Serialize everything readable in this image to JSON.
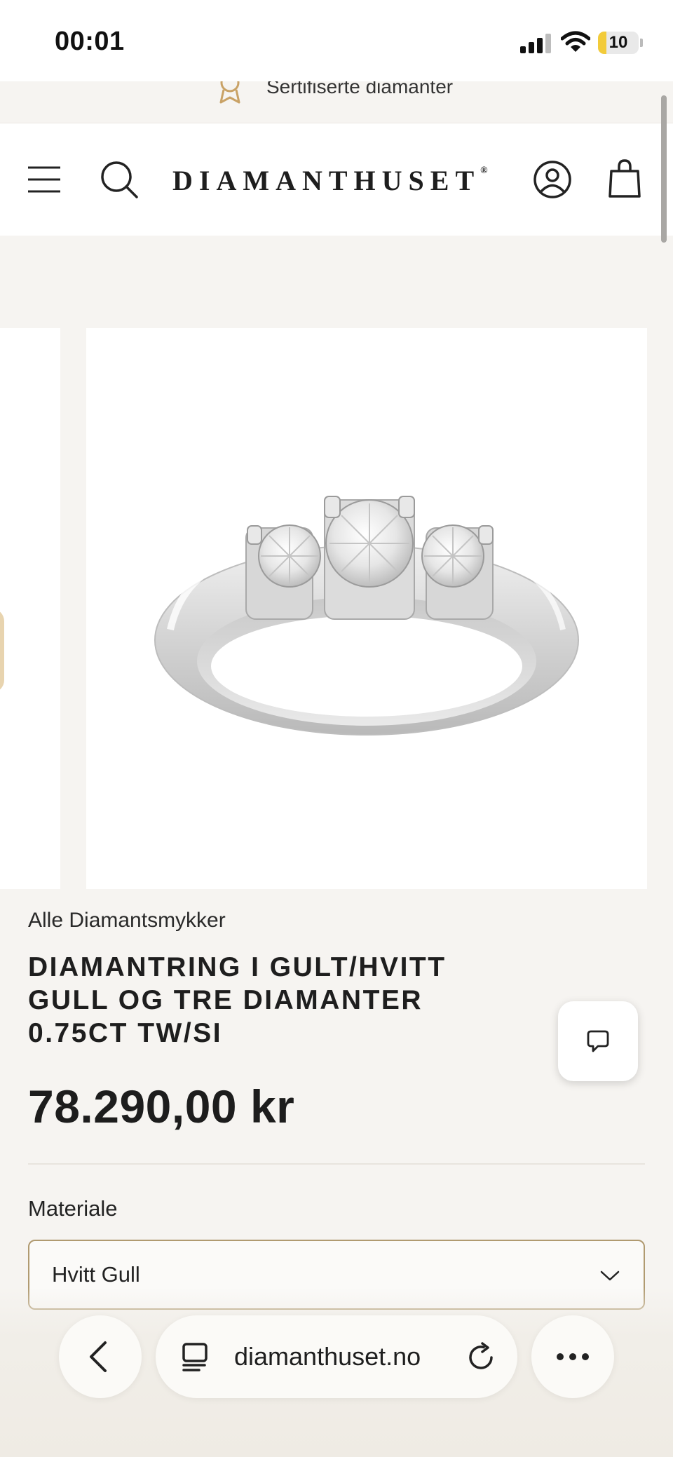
{
  "status_bar": {
    "time": "00:01",
    "battery_label": "10",
    "signal_icon": "cellular-signal-icon",
    "wifi_icon": "wifi-icon",
    "battery_icon": "battery-icon"
  },
  "announcement": {
    "icon": "award-ribbon-icon",
    "text": "Sertifiserte diamanter"
  },
  "header": {
    "logo": "DIAMANTHUSET",
    "logo_mark": "®",
    "icons": [
      "menu-icon",
      "search-icon",
      "account-icon",
      "shopping-bag-icon"
    ]
  },
  "gallery": {
    "main_image": "diamond-ring-image",
    "description_icon": "three-stone-ring"
  },
  "product": {
    "breadcrumb": "Alle Diamantsmykker",
    "title": "DIAMANTRING I GULT/HVITT GULL OG TRE DIAMANTER 0.75CT TW/SI",
    "price": "78.290,00 kr"
  },
  "options": {
    "material_label": "Materiale",
    "material_value": "Hvitt Gull"
  },
  "chat": {
    "icon": "chat-bubble-icon"
  },
  "browser": {
    "url": "diamanthuset.no",
    "back_icon": "back-chevron-icon",
    "tabs_icon": "page-menu-icon",
    "reload_icon": "reload-icon",
    "more_icon": "more-dots-icon"
  },
  "colors": {
    "accent_gold": "#c9a266",
    "select_border": "#b09a70",
    "page_bg": "#f6f4f1"
  }
}
